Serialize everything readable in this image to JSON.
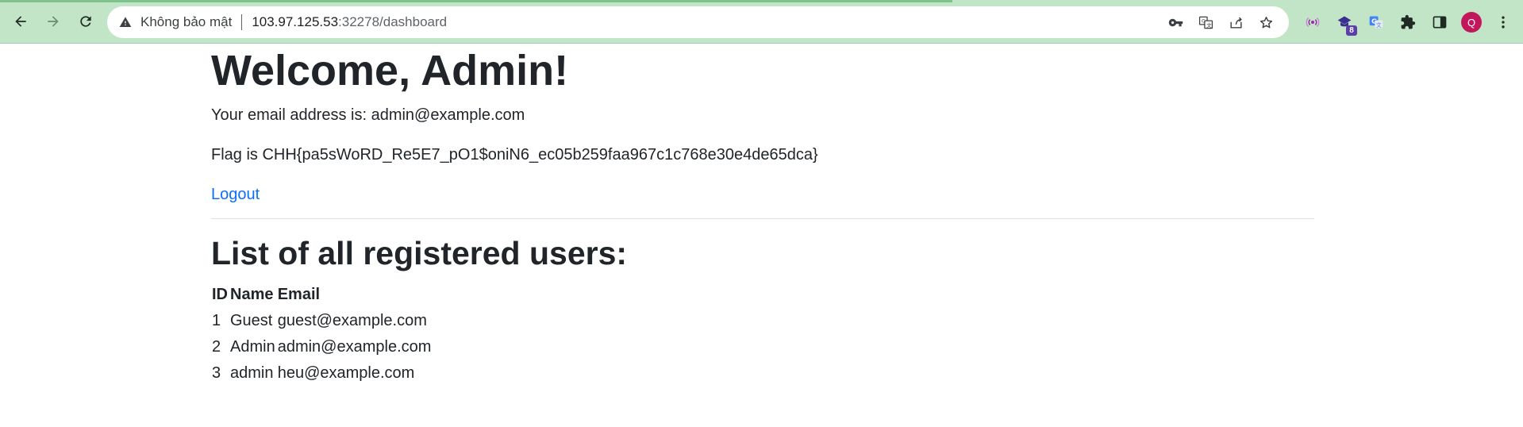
{
  "browser": {
    "security_label": "Không bảo mật",
    "url_host": "103.97.125.53",
    "url_rest": ":32278/dashboard",
    "extension_badge": "8",
    "profile_initial": "Q",
    "icons": {
      "back": "arrow-left-icon",
      "forward": "arrow-right-icon",
      "reload": "reload-icon",
      "warning": "warning-triangle-icon",
      "password": "key-icon",
      "translate": "translate-icon",
      "share": "share-icon",
      "bookmark": "star-icon",
      "extensions": "puzzle-icon",
      "side_panel": "side-panel-icon",
      "menu": "kebab-menu-icon"
    },
    "colors": {
      "frame": "#c2e5c7",
      "avatar": "#c2185b",
      "badge": "#5b3fa8"
    }
  },
  "page": {
    "welcome_title": "Welcome, Admin!",
    "email_text": "Your email address is: admin@example.com",
    "flag_text": "Flag is CHH{pa5sWoRD_Re5E7_pO1$oniN6_ec05b259faa967c1c768e30e4de65dca}",
    "logout_label": "Logout",
    "list_title": "List of all registered users:",
    "link_color": "#0d6efd",
    "table": {
      "headers": {
        "id": "ID",
        "name": "Name",
        "email": "Email"
      },
      "rows": [
        {
          "id": "1",
          "name": "Guest",
          "email": "guest@example.com"
        },
        {
          "id": "2",
          "name": "Admin",
          "email": "admin@example.com"
        },
        {
          "id": "3",
          "name": "admin",
          "email": "heu@example.com"
        }
      ]
    }
  }
}
